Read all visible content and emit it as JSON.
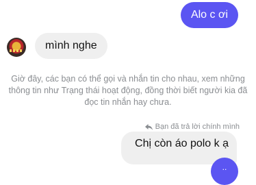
{
  "messages": {
    "outgoing_1": "Alo c ơi",
    "incoming_1": "mình nghe",
    "system_notice": "Giờ đây, các bạn có thể gọi và nhắn tin cho nhau, xem những thông tin như Trạng thái hoạt động, đồng thời biết người kia đã đọc tin nhắn hay chưa.",
    "reply_context": "Bạn đã trả lời chính mình",
    "replied_message": "Chị còn áo polo k ạ",
    "outgoing_partial": ".."
  },
  "icons": {
    "reply": "reply-arrow-icon"
  },
  "colors": {
    "outgoing_bubble": "#5b55f2",
    "incoming_bubble": "#efefef",
    "muted_text": "#8a8d91"
  }
}
